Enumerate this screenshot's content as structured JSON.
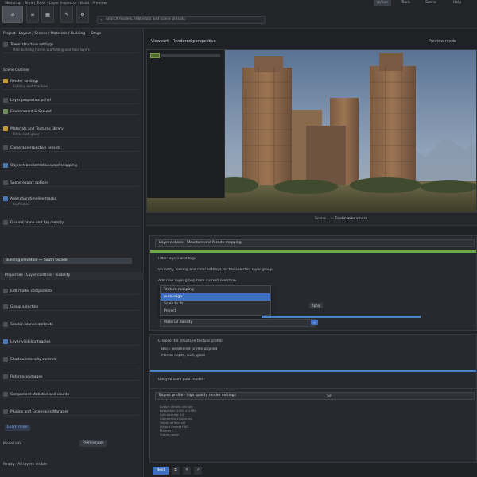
{
  "colors": {
    "accent": "#3f6fc0",
    "green_bar": "#6fa84a",
    "blue_bar": "#4f7fc4",
    "panel_bg": "#26292e"
  },
  "topbar": {
    "title": "Sketchup · Smart Tools · Layer Inspector · Build · Preview",
    "tools": [
      {
        "label": "⌂",
        "icon": "home-icon"
      },
      {
        "label": "≡",
        "icon": "list-icon"
      },
      {
        "label": "▦",
        "icon": "grid-icon"
      },
      {
        "label": "✎",
        "icon": "pencil-icon"
      },
      {
        "label": "⚙",
        "icon": "gear-icon"
      }
    ],
    "search_text": "Search models, materials and scene presets",
    "right_items": [
      "Active",
      "Tools",
      "Scene",
      "Help"
    ]
  },
  "sidebar": {
    "head_lines": [
      "Project / Layout / Scenes / Materials / Building — Stage",
      "Scene Outliner"
    ],
    "items": [
      {
        "label": "Tower structure settings",
        "sub": "Main building frame, scaffolding and floor layers",
        "icon": "folder-icon"
      },
      {
        "label": "Render settings",
        "sub": "Lighting and shadows",
        "icon": "sun-icon"
      },
      {
        "label": "Layer properties panel",
        "sub": "",
        "icon": "layers-icon"
      },
      {
        "label": "Environment & Ground",
        "sub": "",
        "icon": "globe-icon"
      },
      {
        "label": "Materials and Textures library",
        "sub": "Brick, rust, glass",
        "icon": "palette-icon"
      },
      {
        "label": "Camera perspective presets",
        "sub": "",
        "icon": "camera-icon"
      },
      {
        "label": "Object transformations and snapping",
        "sub": "",
        "icon": "move-icon"
      },
      {
        "label": "Scene export options",
        "sub": "",
        "icon": "export-icon"
      },
      {
        "label": "Animation timeline tracks",
        "sub": "Keyframes",
        "icon": "film-icon"
      },
      {
        "label": "Ground plane and fog density",
        "sub": "",
        "icon": "cloud-icon"
      }
    ],
    "selected_label": "Building elevation — South facade",
    "section_title": "Properties · Layer controls · Visibility",
    "lower_items": [
      {
        "label": "Edit model components",
        "sub": "",
        "icon": "edit-icon"
      },
      {
        "label": "Group selection",
        "sub": "",
        "icon": "group-icon"
      },
      {
        "label": "Section planes and cuts",
        "sub": "",
        "icon": "scissors-icon"
      },
      {
        "label": "Layer visibility toggles",
        "sub": "",
        "icon": "eye-icon"
      },
      {
        "label": "Shadow intensity controls",
        "sub": "",
        "icon": "shadow-icon"
      },
      {
        "label": "Reference images",
        "sub": "",
        "icon": "image-icon"
      },
      {
        "label": "Component statistics and counts",
        "sub": "",
        "icon": "stats-icon"
      },
      {
        "label": "Plugins and Extensions Manager",
        "sub": "",
        "icon": "plugin-icon"
      }
    ],
    "link_label": "Learn more",
    "foot_line_1": "Model info",
    "foot_button": "Preferences",
    "foot_line_2": "Ready · All layers visible"
  },
  "main": {
    "title": "Viewport · Rendered perspective",
    "title_right": "Preview mode",
    "caption_left": "Scene 1 — Tower ruins",
    "caption_right": "Scene camera",
    "panel1": {
      "header": "Layer options · Structure and facade mapping",
      "search_value": "Filter layers and tags",
      "line_a": "Visibility, locking and color settings for the selected layer group",
      "section_label": "Add new layer group from current selection",
      "dropdown_items": [
        "Texture mapping",
        "Auto-align",
        "Scale to fit",
        "Project"
      ],
      "dropdown_selected_index": 1,
      "button_a": "Apply",
      "field_label": "Material density",
      "chip": "✓"
    },
    "panel2": {
      "header": "Choose the structure texture profile",
      "lines": [
        "Brick weathered profile applied",
        "Mortar depth, rust, glass"
      ],
      "question": "Did you save your model?"
    },
    "panel3": {
      "header": "Export profile · high quality render settings",
      "right_label": "Set",
      "details": [
        "Export details and log",
        "Resolution 1920 × 1080",
        "Anti-aliasing 4×",
        "Ambient occlusion on",
        "Depth of field off",
        "Output format PNG",
        "Frames 1",
        "Status ready"
      ]
    },
    "footer_buttons": [
      "Next"
    ],
    "footer_icons": [
      "copy-icon",
      "trash-icon",
      "share-icon"
    ]
  }
}
